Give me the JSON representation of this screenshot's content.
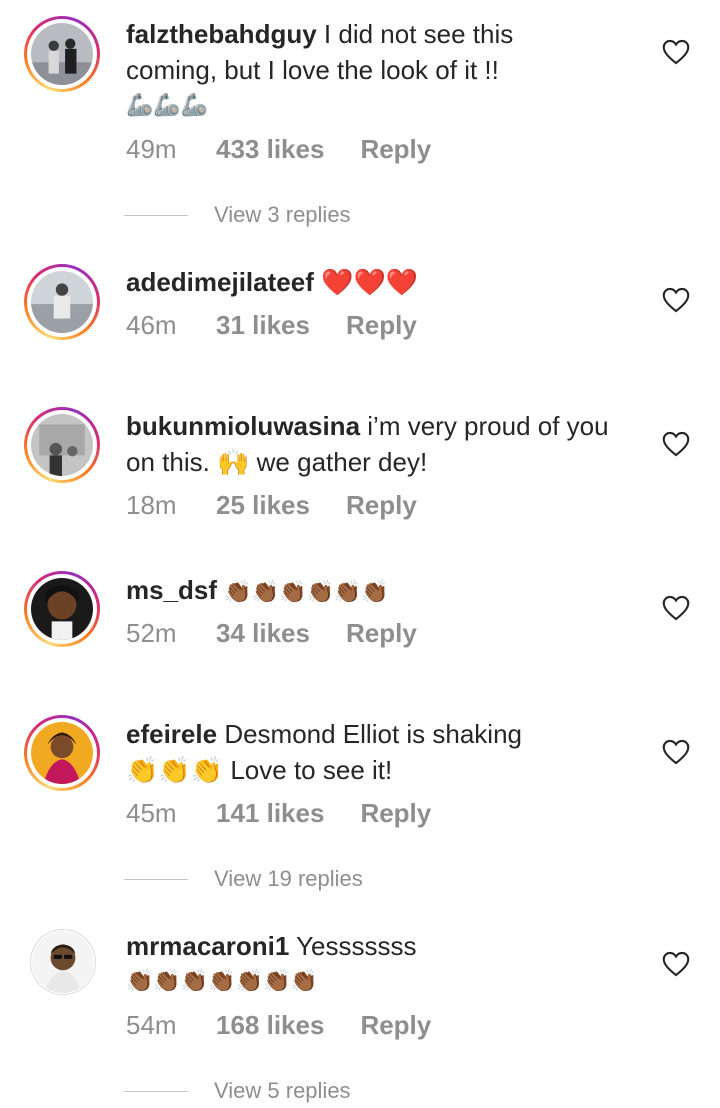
{
  "comments": [
    {
      "username": "falzthebahdguy",
      "text_line1": "I did not see this",
      "text_line2": "coming, but I love the look of it !!",
      "emoji_line": "🦾🦾🦾",
      "time": "49m",
      "likes": "433 likes",
      "reply_label": "Reply",
      "view_replies": "View 3 replies"
    },
    {
      "username": "adedimejilateef",
      "text_line1": "❤️❤️❤️",
      "time": "46m",
      "likes": "31 likes",
      "reply_label": "Reply"
    },
    {
      "username": "bukunmioluwasina",
      "text_line1": "i’m very proud of you",
      "text_line2": "on this. 🙌 we gather dey!",
      "time": "18m",
      "likes": "25 likes",
      "reply_label": "Reply"
    },
    {
      "username": "ms_dsf",
      "text_line1": "👏🏾👏🏾👏🏾👏🏾👏🏾👏🏾",
      "time": "52m",
      "likes": "34 likes",
      "reply_label": "Reply"
    },
    {
      "username": "efeirele",
      "text_line1": "Desmond Elliot is shaking",
      "text_line2": "👏👏👏 Love to see it!",
      "time": "45m",
      "likes": "141 likes",
      "reply_label": "Reply",
      "view_replies": "View 19 replies"
    },
    {
      "username": "mrmacaroni1",
      "text_line1": "Yesssssss",
      "text_line2": "👏🏾👏🏾👏🏾👏🏾👏🏾👏🏾👏🏾",
      "time": "54m",
      "likes": "168 likes",
      "reply_label": "Reply",
      "view_replies": "View 5 replies"
    }
  ],
  "colors": {
    "text": "#262626",
    "secondary": "#8e8e8e",
    "story_ring": "#d62976"
  },
  "icons": {
    "like": "heart-outline-icon"
  }
}
